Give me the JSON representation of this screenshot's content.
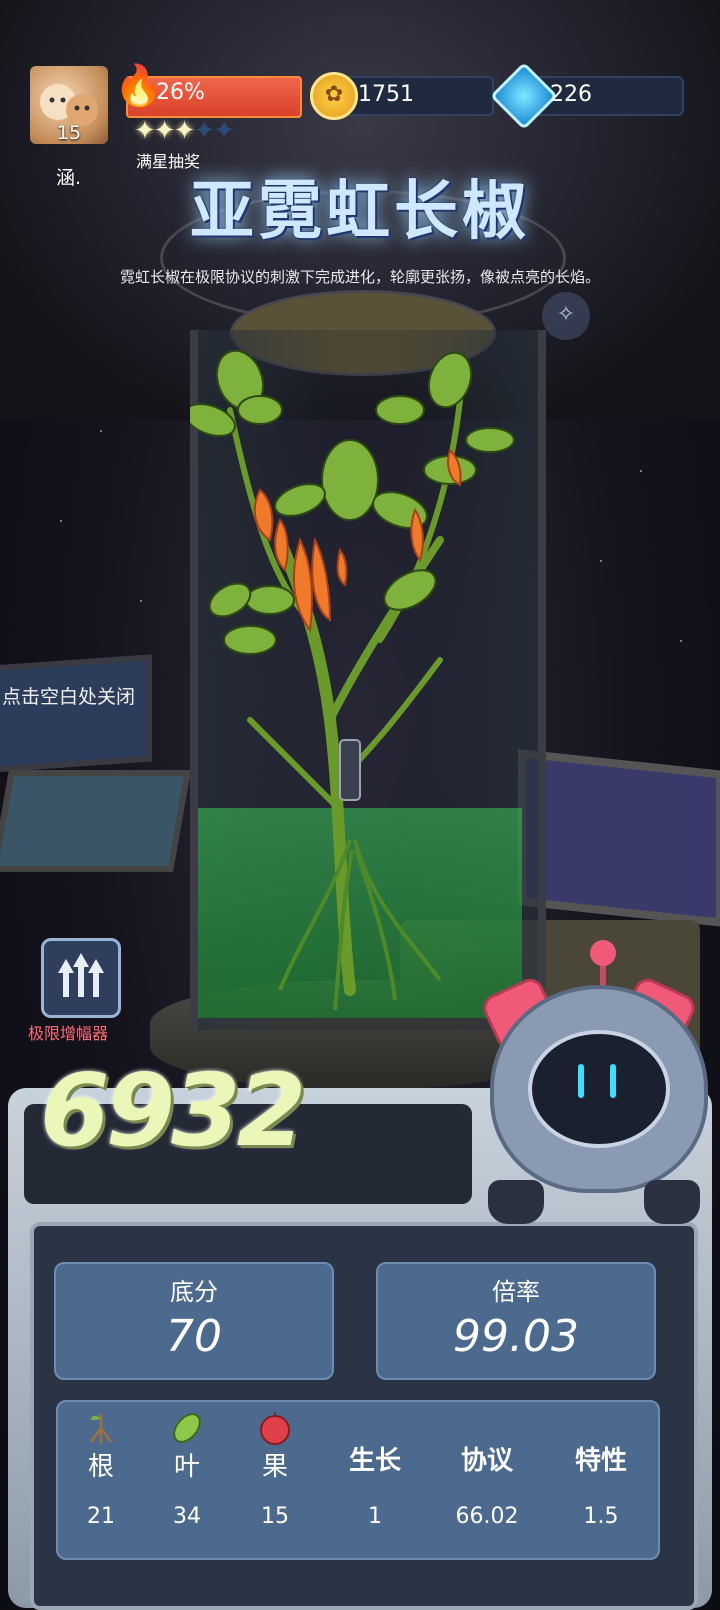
{
  "player": {
    "level": "15",
    "name": "涵."
  },
  "progress": {
    "label": "26%",
    "value": 0.26,
    "stars_filled": 3,
    "stars_total": 5,
    "lottery_label": "满星抽奖"
  },
  "resources": {
    "gold": "1751",
    "gems": "226"
  },
  "plant": {
    "title": "亚霓虹长椒",
    "description": "霓虹长椒在极限协议的刺激下完成进化，轮廓更张扬，像被点亮的长焰。"
  },
  "hint": {
    "close": "点击空白处关闭"
  },
  "amplifier": {
    "label": "极限增幅器"
  },
  "score": {
    "total": "6932",
    "base_label": "底分",
    "base_value": "70",
    "multiplier_label": "倍率",
    "multiplier_value": "99.03"
  },
  "attributes": [
    {
      "label": "根",
      "value": "21",
      "icon": "root-icon"
    },
    {
      "label": "叶",
      "value": "34",
      "icon": "leaf-icon"
    },
    {
      "label": "果",
      "value": "15",
      "icon": "fruit-icon"
    },
    {
      "label": "生长",
      "value": "1"
    },
    {
      "label": "协议",
      "value": "66.02"
    },
    {
      "label": "特性",
      "value": "1.5"
    }
  ],
  "colors": {
    "fire": "#d8422a",
    "title_glow": "#9ad4ff",
    "score_text": "#eaf7b8",
    "panel": "#4c6a8e",
    "amplifier_label": "#ff6a7a",
    "robot_accent": "#f05a78"
  }
}
